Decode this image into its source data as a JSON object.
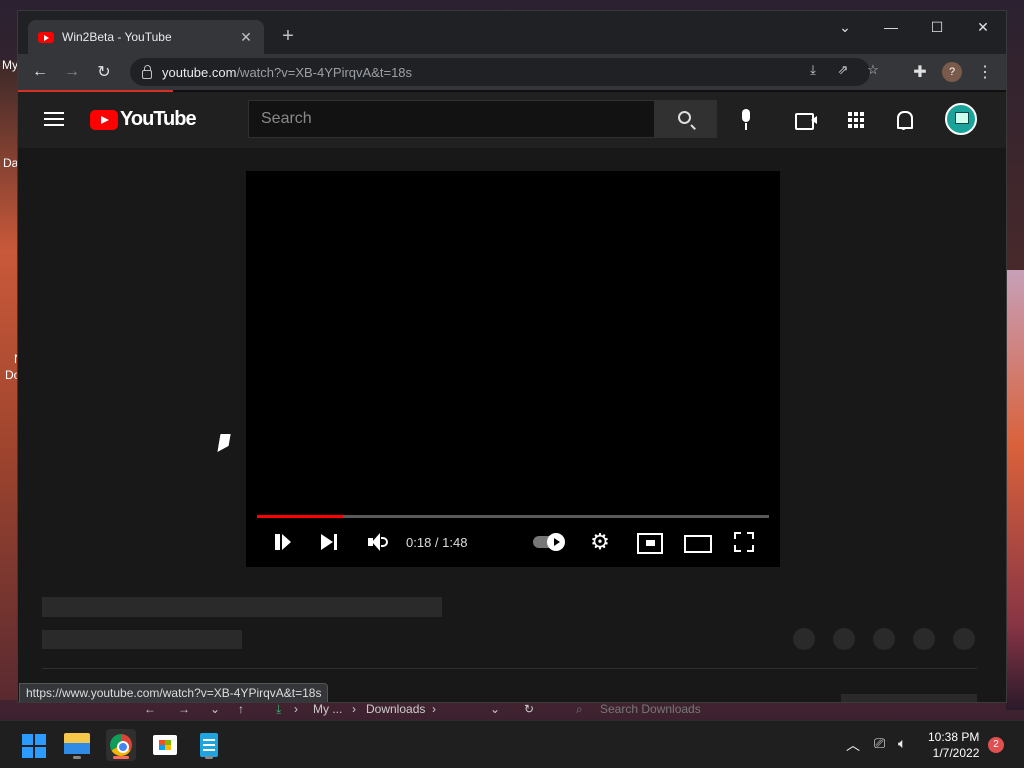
{
  "desktop": {
    "icon_labels": [
      "My",
      "Da",
      "N",
      "Do"
    ]
  },
  "browser": {
    "tab_title": "Win2Beta - YouTube",
    "url_host": "youtube.com",
    "url_path": "/watch?v=XB-4YPirqvA&t=18s",
    "status_url": "https://www.youtube.com/watch?v=XB-4YPirqvA&t=18s",
    "profile_initial": "?"
  },
  "youtube": {
    "logo_text": "YouTube",
    "search_placeholder": "Search"
  },
  "player": {
    "time_current": "0:18",
    "time_total": "1:48",
    "progress_fraction": 0.167,
    "colors": {
      "progress": "#ff0000",
      "accent": "#ff0000"
    }
  },
  "explorer": {
    "path_first": "My ...",
    "path_second": "Downloads",
    "search_placeholder": "Search Downloads"
  },
  "taskbar": {
    "time": "10:38 PM",
    "date": "1/7/2022",
    "notification_count": "2"
  }
}
